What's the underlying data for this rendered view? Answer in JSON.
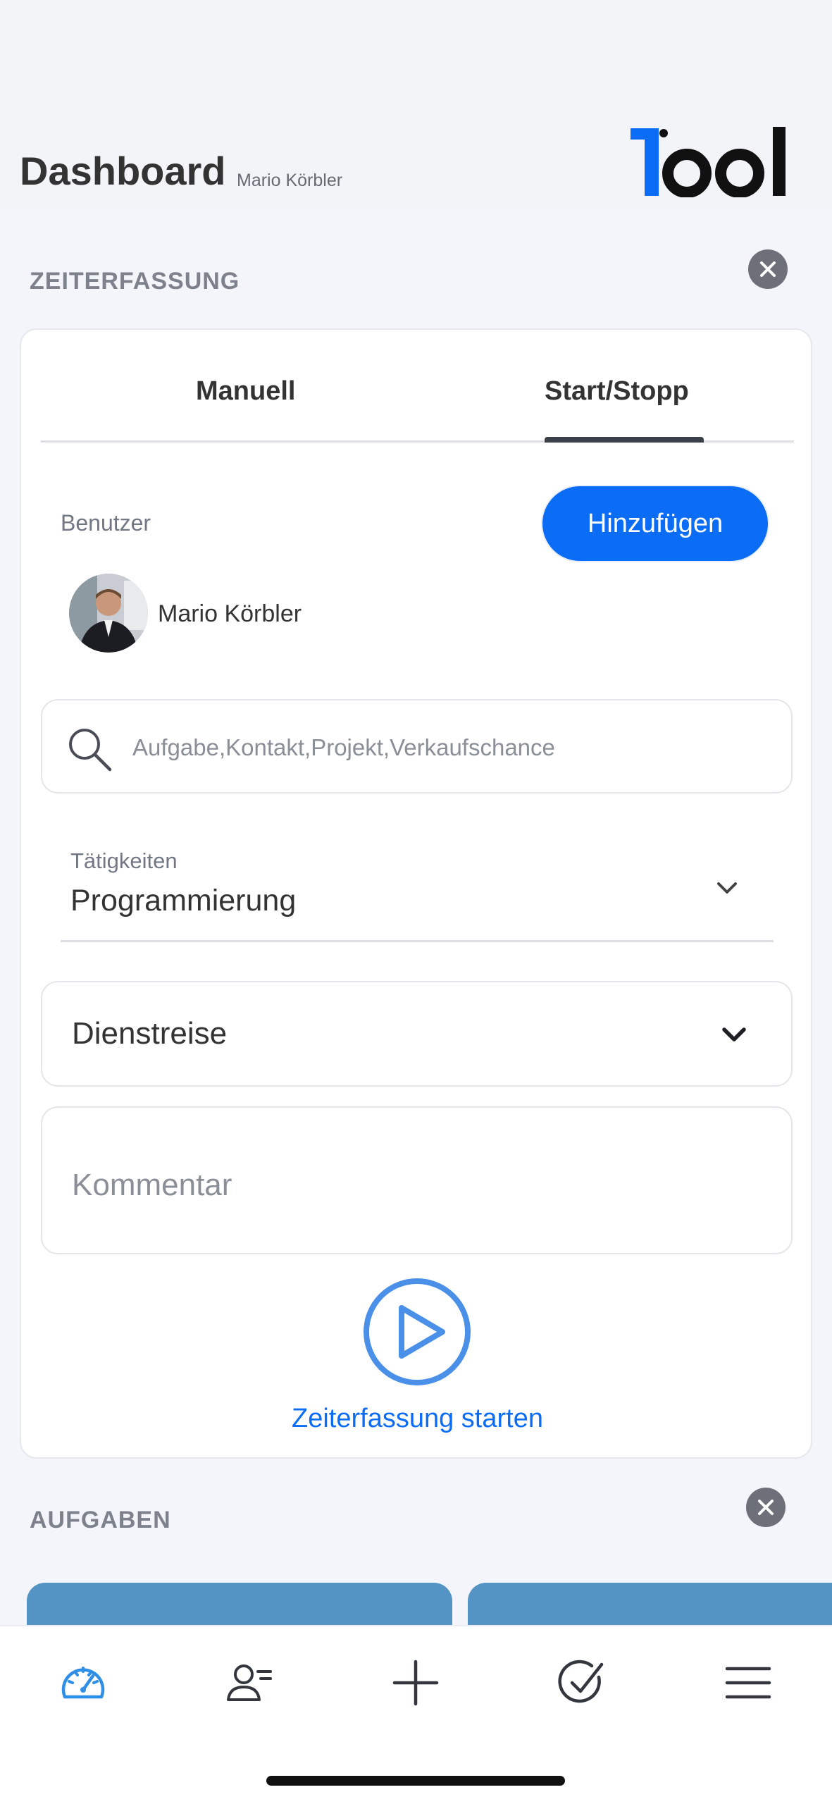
{
  "header": {
    "title": "Dashboard",
    "user": "Mario Körbler",
    "logo_text": "Tool"
  },
  "zeiterfassung": {
    "section_title": "ZEITERFASSUNG",
    "tabs": [
      {
        "label": "Manuell",
        "active": false
      },
      {
        "label": "Start/Stopp",
        "active": true
      }
    ],
    "user_label": "Benutzer",
    "add_button": "Hinzufügen",
    "selected_user": "Mario Körbler",
    "search": {
      "placeholder": "Aufgabe,Kontakt,Projekt,Verkaufschance",
      "value": ""
    },
    "activity": {
      "label": "Tätigkeiten",
      "value": "Programmierung"
    },
    "travel_select": {
      "value": "Dienstreise"
    },
    "comment": {
      "placeholder": "Kommentar",
      "value": ""
    },
    "start_label": "Zeiterfassung starten"
  },
  "aufgaben": {
    "section_title": "AUFGABEN"
  },
  "bottom_nav": {
    "items": [
      {
        "icon": "dashboard-gauge-icon",
        "active": true
      },
      {
        "icon": "contacts-icon",
        "active": false
      },
      {
        "icon": "plus-icon",
        "active": false
      },
      {
        "icon": "tasks-check-icon",
        "active": false
      },
      {
        "icon": "menu-icon",
        "active": false
      }
    ]
  },
  "colors": {
    "accent": "#0b6cf6",
    "play": "#4a90e8",
    "task_card": "#5394c5",
    "close_button": "#6d7079"
  }
}
